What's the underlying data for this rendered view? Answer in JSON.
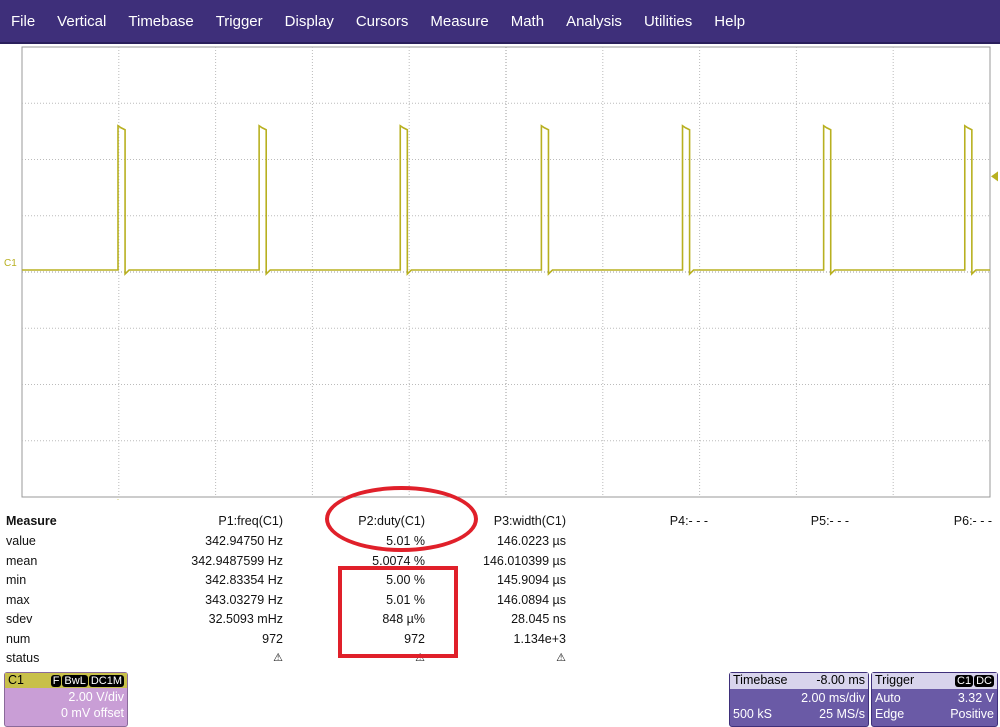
{
  "menu": [
    "File",
    "Vertical",
    "Timebase",
    "Trigger",
    "Display",
    "Cursors",
    "Measure",
    "Math",
    "Analysis",
    "Utilities",
    "Help"
  ],
  "trace": {
    "label": "C1",
    "color": "#b8b020"
  },
  "measure": {
    "header": [
      "Measure",
      "P1:freq(C1)",
      "P2:duty(C1)",
      "P3:width(C1)",
      "P4:- - -",
      "P5:- - -",
      "P6:- - -"
    ],
    "rows": [
      {
        "label": "value",
        "p1": "342.94750 Hz",
        "p2": "5.01 %",
        "p3": "146.0223 µs"
      },
      {
        "label": "mean",
        "p1": "342.9487599 Hz",
        "p2": "5.0074 %",
        "p3": "146.010399 µs"
      },
      {
        "label": "min",
        "p1": "342.83354 Hz",
        "p2": "5.00 %",
        "p3": "145.9094 µs"
      },
      {
        "label": "max",
        "p1": "343.03279 Hz",
        "p2": "5.01 %",
        "p3": "146.0894 µs"
      },
      {
        "label": "sdev",
        "p1": "32.5093 mHz",
        "p2": "848 µ%",
        "p3": "28.045 ns"
      },
      {
        "label": "num",
        "p1": "972",
        "p2": "972",
        "p3": "1.134e+3"
      },
      {
        "label": "status",
        "p1": "⚠",
        "p2": "⚠",
        "p3": "⚠"
      }
    ]
  },
  "channel": {
    "name": "C1",
    "tags": [
      "F",
      "BwL",
      "DC1M"
    ],
    "vdiv": "2.00 V/div",
    "offset": "0 mV offset"
  },
  "timebase": {
    "title": "Timebase",
    "delay": "-8.00 ms",
    "tdiv": "2.00 ms/div",
    "samples": "500 kS",
    "rate": "25 MS/s"
  },
  "trigger": {
    "title": "Trigger",
    "tags": [
      "C1",
      "DC"
    ],
    "mode": "Auto",
    "level": "3.32 V",
    "type": "Edge",
    "slope": "Positive"
  }
}
